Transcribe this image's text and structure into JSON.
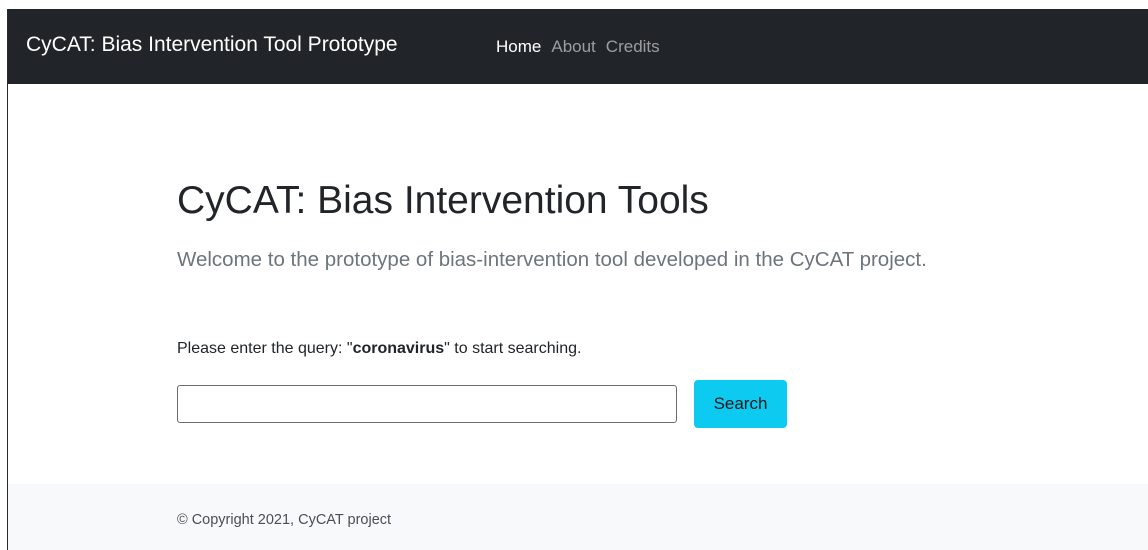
{
  "navbar": {
    "brand": "CyCAT: Bias Intervention Tool Prototype",
    "links": [
      {
        "label": "Home",
        "active": true
      },
      {
        "label": "About",
        "active": false
      },
      {
        "label": "Credits",
        "active": false
      }
    ]
  },
  "main": {
    "title": "CyCAT: Bias Intervention Tools",
    "lead": "Welcome to the prototype of bias-intervention tool developed in the CyCAT project.",
    "instruction": {
      "prefix": "Please enter the query: \"",
      "query": "coronavirus",
      "suffix": "\" to start searching."
    },
    "search": {
      "value": "",
      "placeholder": "",
      "button_label": "Search"
    }
  },
  "footer": {
    "text": "© Copyright 2021, CyCAT project"
  },
  "colors": {
    "navbar_bg": "#212529",
    "button_bg": "#0dcaf0",
    "footer_bg": "#f8f9fa",
    "lead_text": "#6c757d"
  }
}
